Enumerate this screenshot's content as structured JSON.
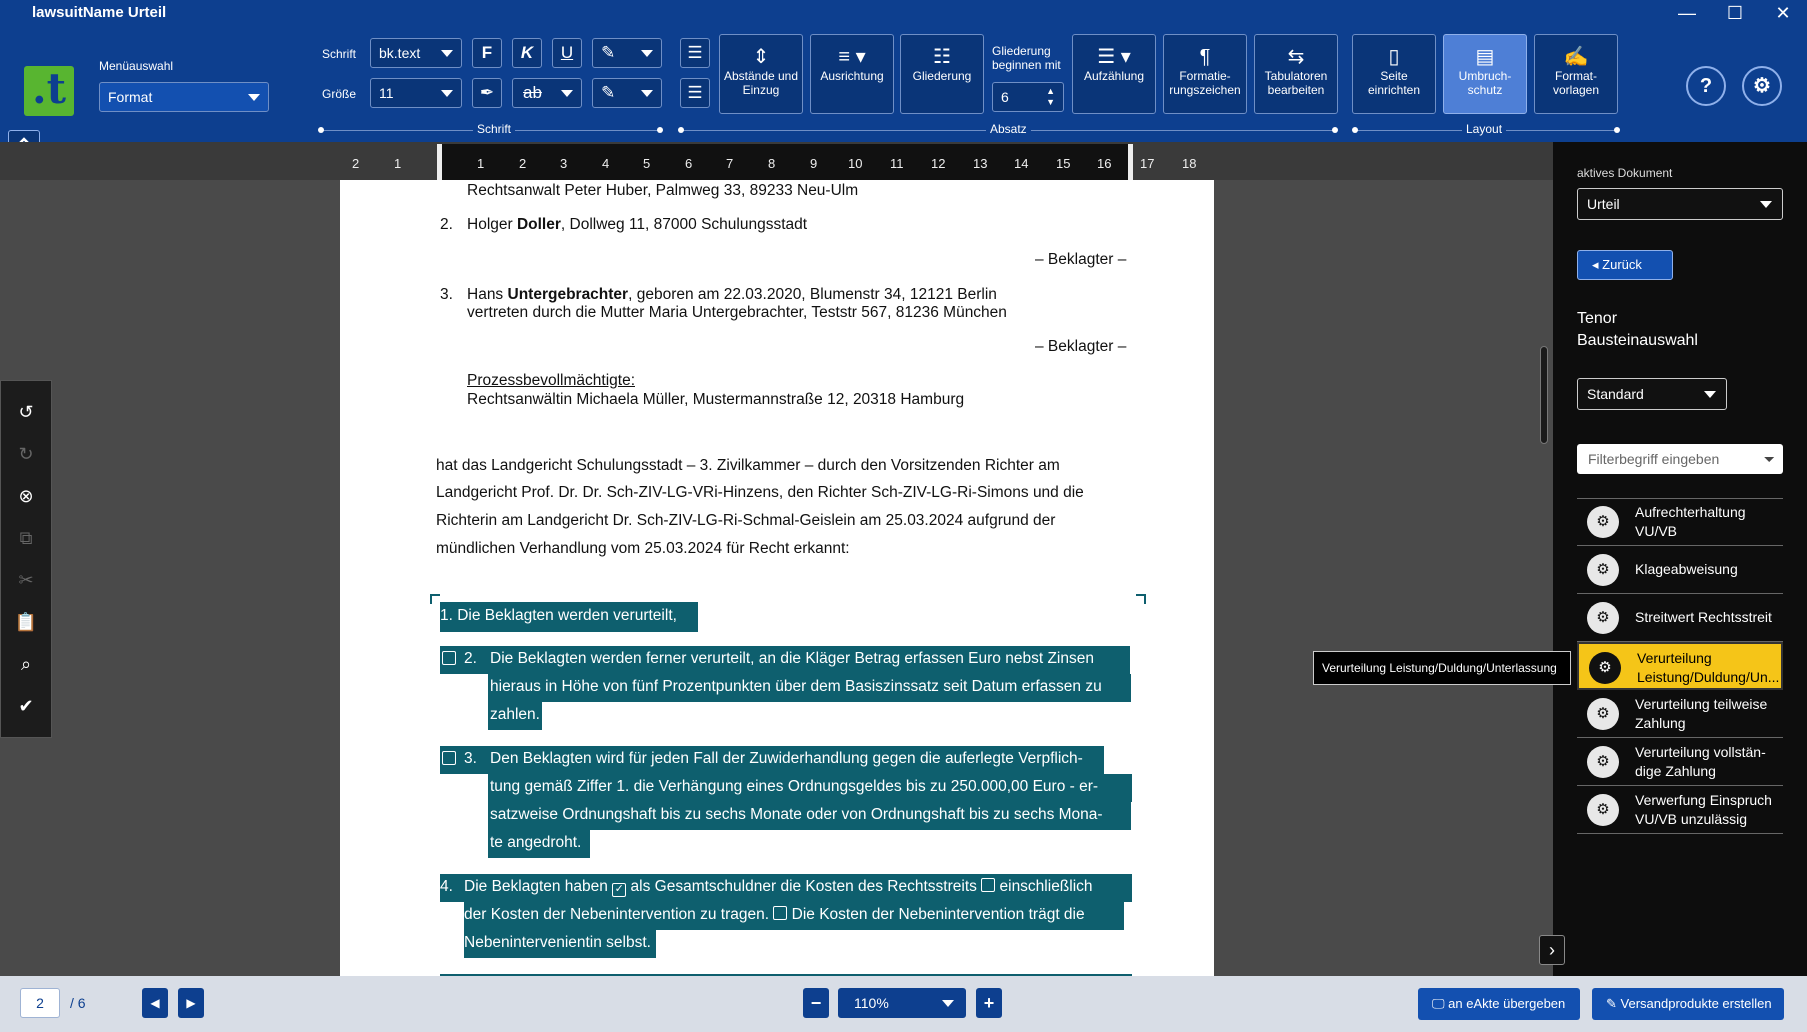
{
  "window": {
    "title": "lawsuitName Urteil",
    "minimize": "—",
    "maximize": "☐",
    "close": "✕"
  },
  "ribbon": {
    "logo": ".t",
    "menu_label": "Menüauswahl",
    "menu_value": "Format",
    "schrift_label": "Schrift",
    "schrift_value": "bk.text",
    "groesse_label": "Größe",
    "groesse_value": "11",
    "buttons": {
      "abstaende": "Abstände und Einzug",
      "ausrichtung": "Ausrichtung",
      "gliederung": "Gliederung",
      "gliederung_beginnen": "Gliederung beginnen mit",
      "gliederung_value": "6",
      "aufzaehlung": "Aufzählung",
      "formatierungszeichen": "Formatie-rungszeichen",
      "tabulatoren": "Tabulatoren bearbeiten",
      "seite": "Seite einrichten",
      "umbruchschutz": "Umbruch-schutz",
      "formatvorlagen": "Format-vorlagen"
    },
    "groups": {
      "schrift": "Schrift",
      "absatz": "Absatz",
      "layout": "Layout"
    }
  },
  "ruler": {
    "left_ticks": [
      "2",
      "1"
    ],
    "ticks": [
      "1",
      "2",
      "3",
      "4",
      "5",
      "6",
      "7",
      "8",
      "9",
      "10",
      "11",
      "12",
      "13",
      "14",
      "15",
      "16",
      "17",
      "18"
    ]
  },
  "document": {
    "l1": "Rechtsanwalt Peter Huber, Palmweg 33, 89233 Neu-Ulm",
    "p2_num": "2.",
    "p2_a": "Holger ",
    "p2_b": "Doller",
    "p2_c": ", Dollweg 11, 87000 Schulungsstadt",
    "beklagter1": "– Beklagter –",
    "p3_num": "3.",
    "p3_a": "Hans ",
    "p3_b": "Untergebrachter",
    "p3_c": ", geboren am 22.03.2020, Blumenstr 34, 12121 Berlin",
    "p3_line2": "vertreten durch die Mutter Maria Untergebrachter, Teststr 567, 81236 München",
    "beklagter2": "– Beklagter –",
    "prozess_label": "Prozessbevollmächtigte:",
    "prozess_value": "Rechtsanwältin Michaela Müller, Mustermannstraße 12, 20318 Hamburg",
    "body1": "hat das Landgericht Schulungsstadt – 3. Zivilkammer – durch den Vorsitzenden Richter am",
    "body2": "Landgericht Prof. Dr. Dr. Sch-ZIV-LG-VRi-Hinzens, den Richter Sch-ZIV-LG-Ri-Simons und die",
    "body3": "Richterin am Landgericht Dr. Sch-ZIV-LG-Ri-Schmal-Geislein am 25.03.2024 aufgrund der",
    "body4": "mündlichen Verhandlung vom 25.03.2024 für Recht erkannt:",
    "t1": "1.   Die Beklagten werden verurteilt,",
    "t2_num": "2.",
    "t2_l1": "Die Beklagten werden ferner verurteilt, an die Kläger Betrag erfassen Euro nebst Zinsen",
    "t2_l2": "hieraus in Höhe von fünf Prozentpunkten über dem Basiszinssatz seit Datum erfassen zu",
    "t2_l3": "zahlen.",
    "t3_num": "3.",
    "t3_l1": "Den Beklagten wird für jeden Fall der Zuwiderhandlung gegen die auferlegte Verpflich-",
    "t3_l2": "tung gemäß Ziffer 1. die Verhängung eines Ordnungsgeldes bis zu 250.000,00 Euro - er-",
    "t3_l3": "satzweise Ordnungshaft bis zu sechs Monate oder von Ordnungshaft bis zu sechs Mona-",
    "t3_l4": "te angedroht.",
    "t4_num": "4.",
    "t4_a": "Die Beklagten haben",
    "t4_b": "als Gesamtschuldner die Kosten des Rechtsstreits",
    "t4_c": "einschließlich",
    "t4_l2a": "der Kosten der Nebenintervention zu tragen.",
    "t4_l2b": "Die Kosten der Nebenintervention trägt die",
    "t4_l3": "Nebenintervenientin selbst."
  },
  "panel": {
    "aktives_label": "aktives Dokument",
    "aktives_value": "Urteil",
    "zurueck": "Zurück",
    "tenor": "Tenor",
    "bausteinauswahl": "Bausteinauswahl",
    "standard": "Standard",
    "filter_placeholder": "Filterbegriff eingeben",
    "items": [
      "Aufrechterhaltung VU/VB",
      "Klageabweisung",
      "Streitwert Rechtsstreit",
      "Verurteilung Leistung/Duldung/Un...",
      "Verurteilung teilweise Zahlung",
      "Verurteilung vollstän-dige Zahlung",
      "Verwerfung Einspruch VU/VB unzulässig"
    ],
    "tooltip": "Verurteilung Leistung/Duldung/Unterlassung"
  },
  "bottom": {
    "page": "2",
    "of": "/ 6",
    "zoom": "110%",
    "eakte": "an eAkte übergeben",
    "versand": "Versandprodukte erstellen"
  },
  "colors": {
    "ribbon": "#0d3f8f",
    "highlight": "#0e5f6e",
    "selected_item": "#f5c518",
    "logo": "#58b530"
  }
}
